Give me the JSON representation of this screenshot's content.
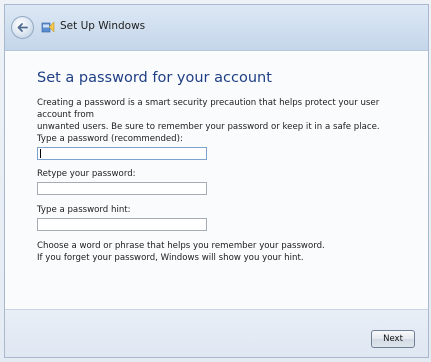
{
  "window": {
    "title": "Set Up Windows",
    "back_icon": "back-arrow-icon",
    "app_icon": "setup-windows-icon"
  },
  "main": {
    "heading": "Set a password for your account",
    "description_line1": "Creating a password is a smart security precaution that helps protect your user account from",
    "description_line2": "unwanted users. Be sure to remember your password or keep it in a safe place.",
    "password_label": "Type a password (recommended):",
    "password_value": "",
    "retype_label": "Retype your password:",
    "retype_value": "",
    "hint_label": "Type a password hint:",
    "hint_value": "",
    "hint_help_line1": "Choose a word or phrase that helps you remember your password.",
    "hint_help_line2": "If you forget your password, Windows will show you your hint."
  },
  "footer": {
    "next_label": "Next"
  },
  "colors": {
    "heading": "#1f3f85",
    "titlebar": "#cfdeef",
    "footer": "#e2e9f3"
  }
}
